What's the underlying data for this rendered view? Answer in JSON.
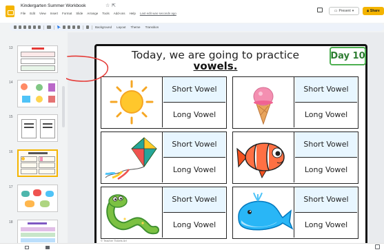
{
  "app": {
    "doc_title": "Kindergarten Summer Workbook",
    "menu": [
      "File",
      "Edit",
      "View",
      "Insert",
      "Format",
      "Slide",
      "Arrange",
      "Tools",
      "Add-ons",
      "Help"
    ],
    "last_edit": "Last edit was seconds ago",
    "present_label": "Present",
    "share_label": "Share",
    "brand_color": "#f4b400"
  },
  "toolbar": {
    "labels": [
      "Background",
      "Layout",
      "Theme",
      "Transition"
    ]
  },
  "filmstrip": {
    "slides": [
      {
        "number": "13"
      },
      {
        "number": "14"
      },
      {
        "number": "15"
      },
      {
        "number": "16",
        "selected": true
      },
      {
        "number": "17"
      },
      {
        "number": "18"
      }
    ]
  },
  "slide": {
    "heading": "Today, we are going to practice",
    "heading_bold": "vowels.",
    "day_badge": "Day 10",
    "credit": "© Teacher Tickets Art",
    "cards": [
      {
        "picture": "sun",
        "short": "Short Vowel",
        "long": "Long Vowel"
      },
      {
        "picture": "ice-cream",
        "short": "Short Vowel",
        "long": "Long Vowel"
      },
      {
        "picture": "kite",
        "short": "Short Vowel",
        "long": "Long Vowel"
      },
      {
        "picture": "fish",
        "short": "Short Vowel",
        "long": "Long Vowel"
      },
      {
        "picture": "snake",
        "short": "Short Vowel",
        "long": "Long Vowel"
      },
      {
        "picture": "whale",
        "short": "Short Vowel",
        "long": "Long Vowel"
      }
    ]
  },
  "colors": {
    "badge_green": "#4caf50",
    "annotation_red": "#e53935",
    "selected_outline": "#f4b400"
  }
}
